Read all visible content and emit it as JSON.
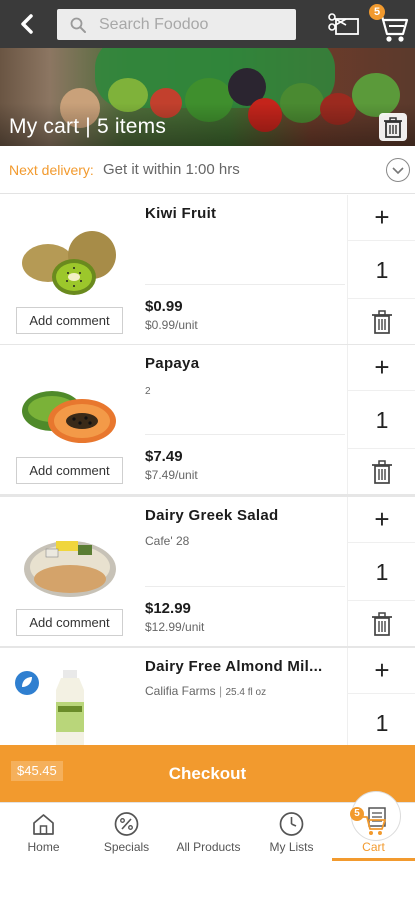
{
  "topbar": {
    "search_placeholder": "Search Foodoo",
    "cart_badge": "5"
  },
  "hero": {
    "title": "My cart | 5 items"
  },
  "delivery": {
    "label": "Next delivery:",
    "value": "Get it within 1:00 hrs"
  },
  "items": [
    {
      "name": "Kiwi Fruit",
      "brand": "",
      "size": "",
      "price": "$0.99",
      "unit_price": "$0.99/unit",
      "qty": "1",
      "comment_label": "Add comment"
    },
    {
      "name": "Papaya",
      "brand": "",
      "size": "2",
      "price": "$7.49",
      "unit_price": "$7.49/unit",
      "qty": "1",
      "comment_label": "Add comment"
    },
    {
      "name": "Dairy Greek Salad",
      "brand": "Cafe' 28",
      "size": "",
      "price": "$12.99",
      "unit_price": "$12.99/unit",
      "qty": "1",
      "comment_label": "Add comment"
    },
    {
      "name": "Dairy Free Almond Mil...",
      "brand": "Califia Farms",
      "brand_sep": "|",
      "size": "25.4 fl oz",
      "price": "",
      "unit_price": "",
      "qty": "1",
      "comment_label": ""
    }
  ],
  "checkout": {
    "total": "$45.45",
    "label": "Checkout"
  },
  "nav": {
    "home": "Home",
    "specials": "Specials",
    "all_products": "All Products",
    "my_lists": "My Lists",
    "cart": "Cart",
    "cart_badge": "5"
  },
  "colors": {
    "accent": "#f29a2e",
    "topbar": "#3a3a3a"
  }
}
